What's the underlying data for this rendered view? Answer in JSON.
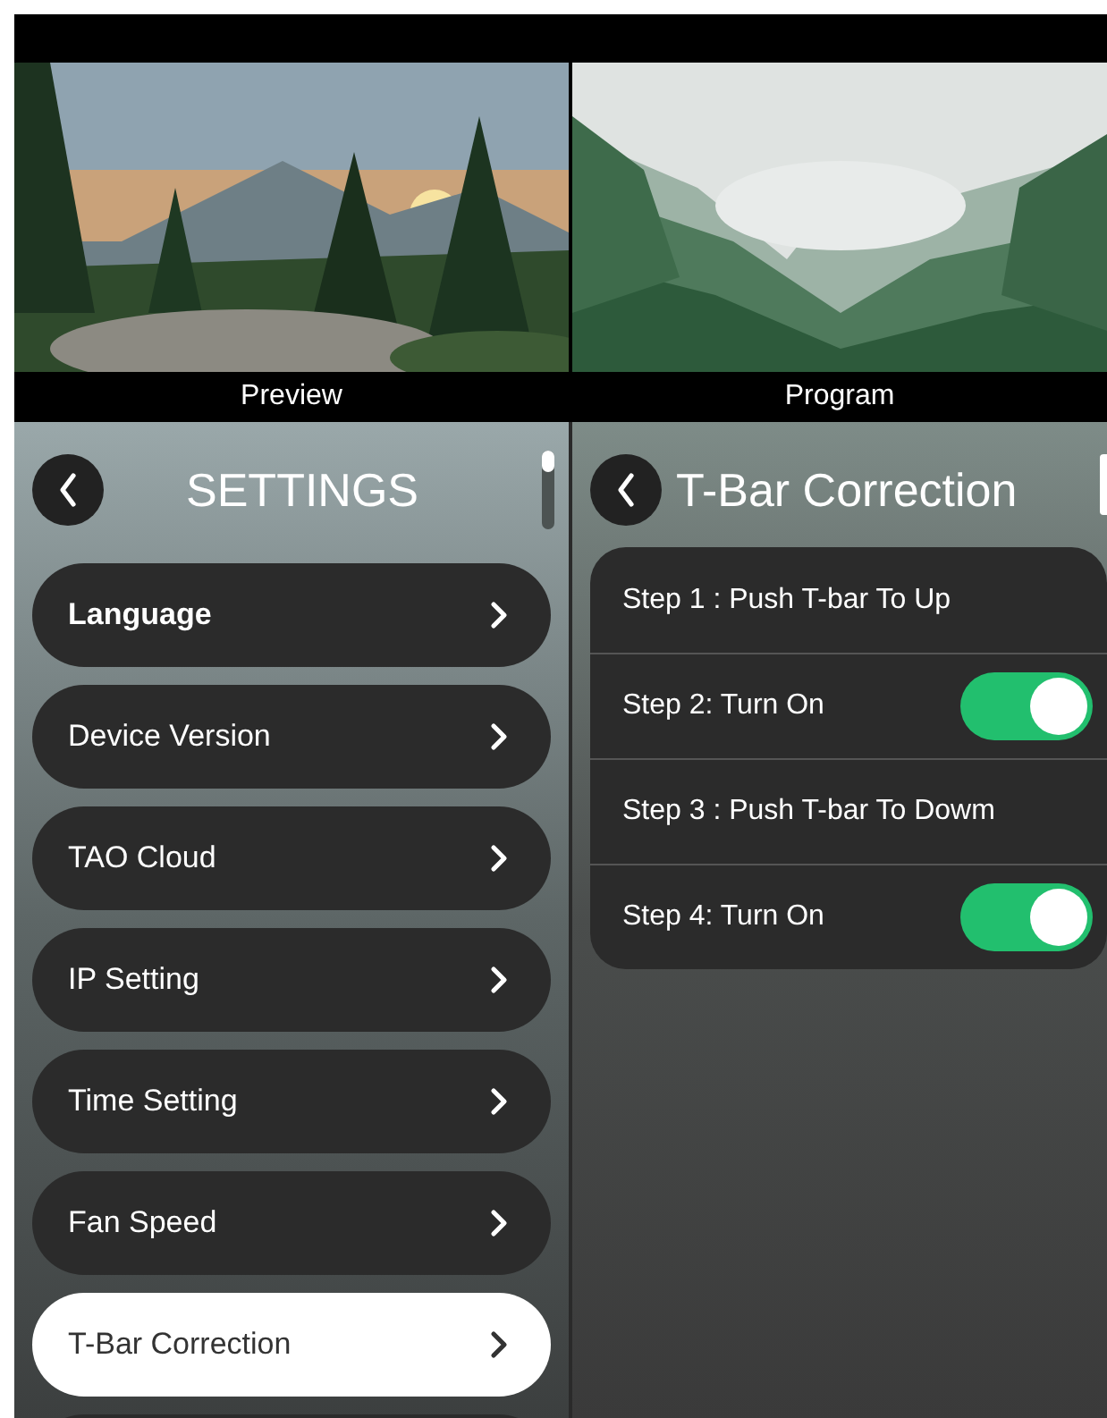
{
  "monitors": [
    {
      "label": "Preview"
    },
    {
      "label": "Program"
    }
  ],
  "settings": {
    "title": "SETTINGS",
    "items": [
      {
        "label": "Language",
        "selected": false,
        "bold": true
      },
      {
        "label": "Device Version",
        "selected": false,
        "bold": false
      },
      {
        "label": "TAO Cloud",
        "selected": false,
        "bold": false
      },
      {
        "label": "IP Setting",
        "selected": false,
        "bold": false
      },
      {
        "label": "Time Setting",
        "selected": false,
        "bold": false
      },
      {
        "label": "Fan Speed",
        "selected": false,
        "bold": false
      },
      {
        "label": "T-Bar Correction",
        "selected": true,
        "bold": false
      }
    ]
  },
  "tbar": {
    "title": "T-Bar Correction",
    "steps": [
      {
        "kind": "text",
        "label": "Step 1 : Push T-bar To Up"
      },
      {
        "kind": "toggle",
        "label": "Step 2: Turn On",
        "on": true
      },
      {
        "kind": "text",
        "label": "Step 3 : Push T-bar To Dowm"
      },
      {
        "kind": "toggle",
        "label": "Step 4: Turn On",
        "on": true
      }
    ]
  }
}
